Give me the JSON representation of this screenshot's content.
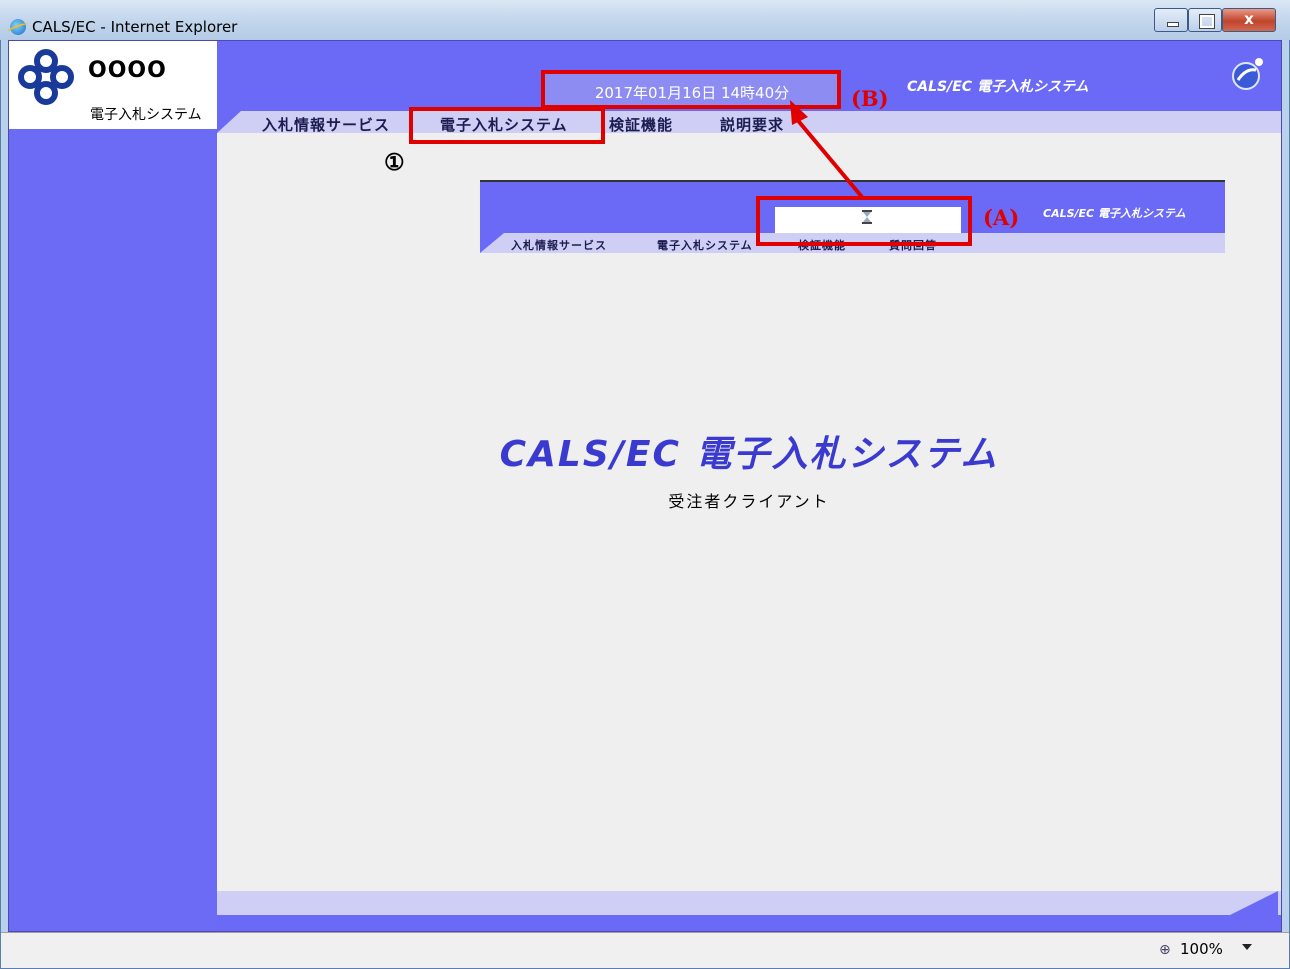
{
  "window": {
    "title": "CALS/EC - Internet Explorer",
    "close_label": "x"
  },
  "logo": {
    "name": "OOOO",
    "subtitle": "電子入札システム"
  },
  "header": {
    "datetime": "2017年01月16日 14時40分",
    "brand": "CALS/EC 電子入札システム"
  },
  "menu": {
    "items": [
      {
        "label": "入札情報サービス"
      },
      {
        "label": "電子入札システム"
      },
      {
        "label": "検証機能"
      },
      {
        "label": "説明要求"
      }
    ]
  },
  "inset": {
    "brand": "CALS/EC 電子入札システム",
    "menu": [
      {
        "label": "入札情報サービス"
      },
      {
        "label": "電子入札システム"
      },
      {
        "label": "検証機能"
      },
      {
        "label": "質問回答"
      }
    ]
  },
  "annotations": {
    "b": "(B)",
    "a": "(A)",
    "one": "①"
  },
  "main": {
    "title": "CALS/EC 電子入札システム",
    "subtitle": "受注者クライアント"
  },
  "statusbar": {
    "zoom": "100%"
  },
  "colors": {
    "header_blue": "#6a6af6",
    "menu_lavender": "#cfcff6",
    "annotation_red": "#e00000"
  }
}
